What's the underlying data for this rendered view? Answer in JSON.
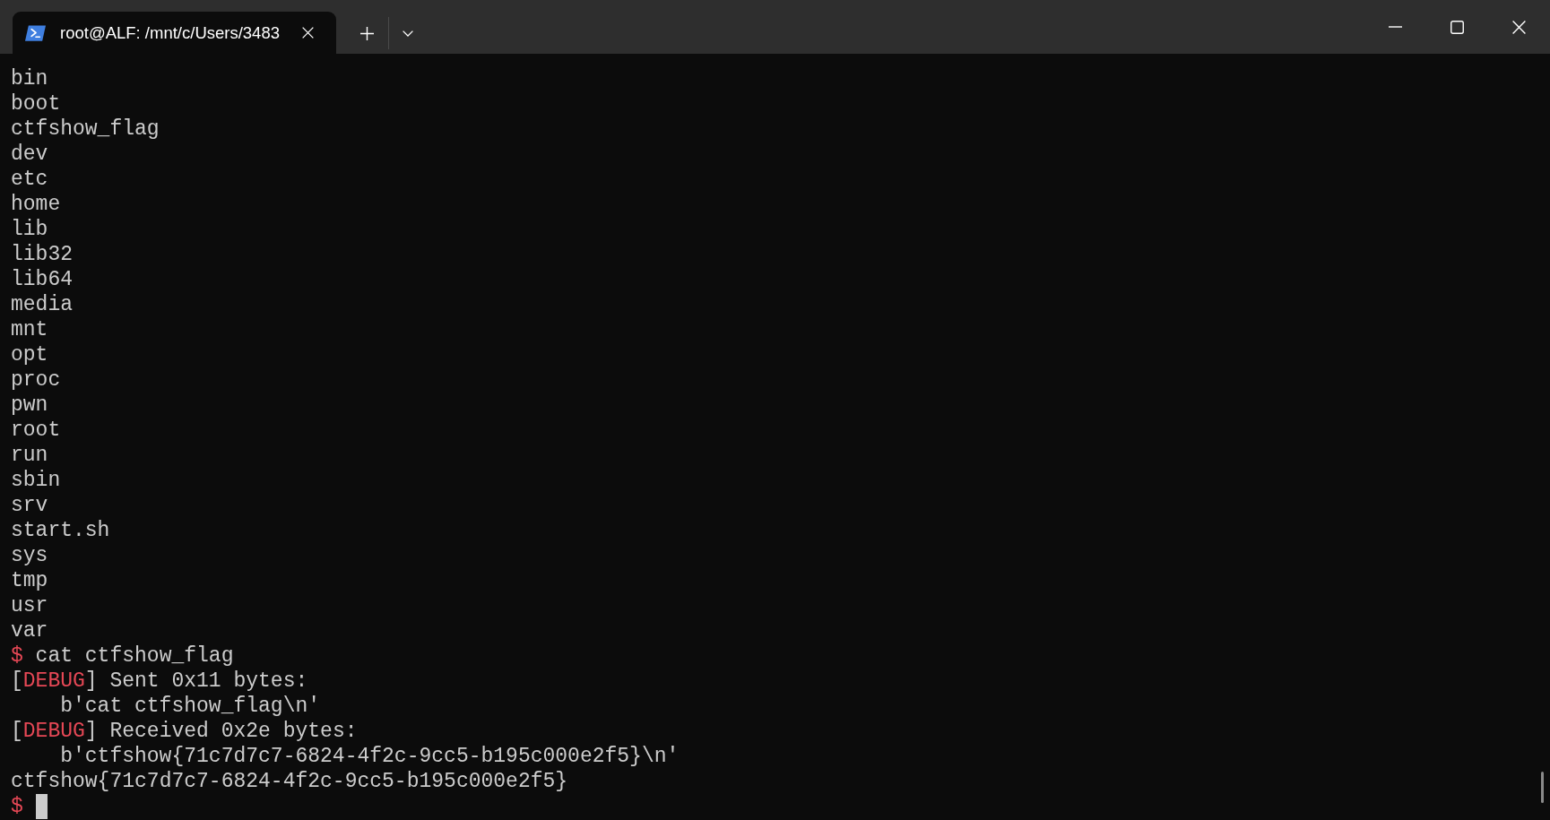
{
  "window": {
    "tabs": [
      {
        "title": "root@ALF: /mnt/c/Users/3483",
        "selected": true
      }
    ]
  },
  "terminal": {
    "lines": [
      {
        "kind": "output",
        "text": "bin"
      },
      {
        "kind": "output",
        "text": "boot"
      },
      {
        "kind": "output",
        "text": "ctfshow_flag"
      },
      {
        "kind": "output",
        "text": "dev"
      },
      {
        "kind": "output",
        "text": "etc"
      },
      {
        "kind": "output",
        "text": "home"
      },
      {
        "kind": "output",
        "text": "lib"
      },
      {
        "kind": "output",
        "text": "lib32"
      },
      {
        "kind": "output",
        "text": "lib64"
      },
      {
        "kind": "output",
        "text": "media"
      },
      {
        "kind": "output",
        "text": "mnt"
      },
      {
        "kind": "output",
        "text": "opt"
      },
      {
        "kind": "output",
        "text": "proc"
      },
      {
        "kind": "output",
        "text": "pwn"
      },
      {
        "kind": "output",
        "text": "root"
      },
      {
        "kind": "output",
        "text": "run"
      },
      {
        "kind": "output",
        "text": "sbin"
      },
      {
        "kind": "output",
        "text": "srv"
      },
      {
        "kind": "output",
        "text": "start.sh"
      },
      {
        "kind": "output",
        "text": "sys"
      },
      {
        "kind": "output",
        "text": "tmp"
      },
      {
        "kind": "output",
        "text": "usr"
      },
      {
        "kind": "output",
        "text": "var"
      },
      {
        "kind": "prompt",
        "prompt": "$",
        "command": "cat ctfshow_flag"
      },
      {
        "kind": "debug",
        "open": "[",
        "tag": "DEBUG",
        "close": "]",
        "text": "Sent 0x11 bytes:"
      },
      {
        "kind": "bytes",
        "text": "b'cat ctfshow_flag\\n'"
      },
      {
        "kind": "debug",
        "open": "[",
        "tag": "DEBUG",
        "close": "]",
        "text": "Received 0x2e bytes:"
      },
      {
        "kind": "bytes",
        "text": "b'ctfshow{71c7d7c7-6824-4f2c-9cc5-b195c000e2f5}\\n'"
      },
      {
        "kind": "output",
        "text": "ctfshow{71c7d7c7-6824-4f2c-9cc5-b195c000e2f5}"
      },
      {
        "kind": "prompt",
        "prompt": "$",
        "cursor": true
      }
    ]
  }
}
